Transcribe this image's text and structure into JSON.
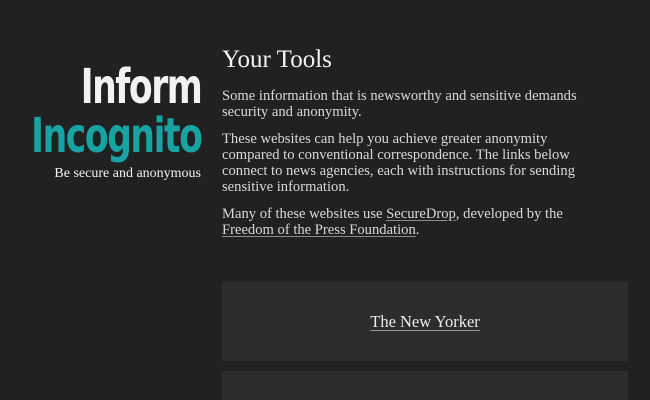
{
  "brand": {
    "line1": "Inform",
    "line2": "Incognito",
    "tagline": "Be secure and anonymous"
  },
  "main": {
    "title": "Your Tools",
    "para1": "Some information that is newsworthy and sensitive demands security and anonymity.",
    "para2": "These websites can help you achieve greater anonymity compared to conventional correspondence. The links below connect to news agencies, each with instructions for sending sensitive information.",
    "para3_prefix": "Many of these websites use ",
    "para3_link1": "SecureDrop",
    "para3_middle": ", developed by the ",
    "para3_link2": "Freedom of the Press Foundation",
    "para3_suffix": "."
  },
  "cards": [
    {
      "label": "The New Yorker"
    },
    {
      "label": ""
    }
  ],
  "colors": {
    "background": "#212121",
    "card": "#2d2d2d",
    "accent": "#17a3a1",
    "text": "#e6e6e6"
  }
}
